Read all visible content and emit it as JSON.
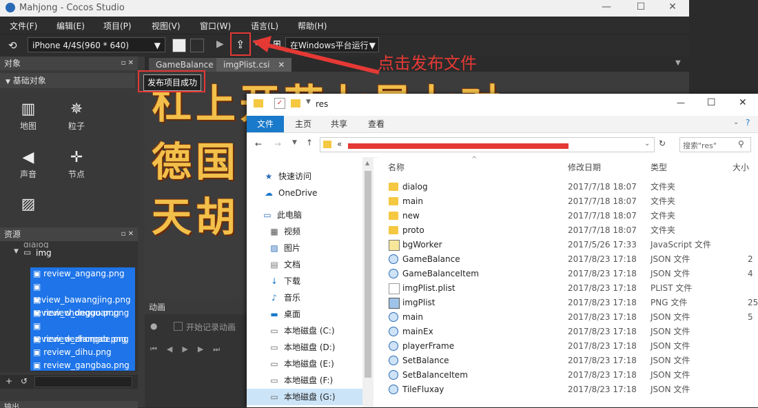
{
  "window": {
    "title": "Mahjong - Cocos Studio"
  },
  "menu": [
    "文件(F)",
    "编辑(E)",
    "项目(P)",
    "视图(V)",
    "窗口(W)",
    "语言(L)",
    "帮助(H)"
  ],
  "toolbar": {
    "device": "iPhone 4/4S(960 * 640)",
    "run_target": "在Windows平台运行"
  },
  "objects_panel": {
    "title": "对象",
    "section": "基础对象",
    "items": [
      {
        "label": "地图",
        "icon": "map-icon"
      },
      {
        "label": "粒子",
        "icon": "particle-icon"
      },
      {
        "label": "声音",
        "icon": "sound-icon"
      },
      {
        "label": "节点",
        "icon": "node-icon"
      },
      {
        "label": "",
        "icon": "image-icon"
      }
    ]
  },
  "resources_panel": {
    "title": "资源",
    "partial_item": "dialog",
    "folder": "img",
    "files": [
      "review_angang.png",
      "review_bawangjing.png",
      "review_chongguan.png",
      "review_deguo.png",
      "review_dezhongde.png",
      "review_dianpao.png",
      "review_dihu.png",
      "review_gangbao.png"
    ]
  },
  "tabs": [
    "GameBalance",
    "imgPlist.csi"
  ],
  "canvas": {
    "calligraphy": [
      "杠上开花七星七对",
      "德国",
      "天胡"
    ]
  },
  "success_message": "发布项目成功",
  "animation_panel": {
    "title": "动画",
    "record_label": "开始记录动画"
  },
  "output_panel": {
    "title": "输出"
  },
  "annotation": {
    "text": "点击发布文件",
    "color": "#e53935"
  },
  "explorer": {
    "title": "res",
    "ribbon_tabs": [
      "文件",
      "主页",
      "共享",
      "查看"
    ],
    "search_placeholder": "搜索\"res\"",
    "address_prefix": "«",
    "nav": [
      {
        "label": "快速访问",
        "icon": "star-icon"
      },
      {
        "label": "OneDrive",
        "icon": "cloud-icon"
      },
      {
        "label": "此电脑",
        "icon": "computer-icon"
      },
      {
        "label": "视频",
        "icon": "video-icon"
      },
      {
        "label": "图片",
        "icon": "picture-icon"
      },
      {
        "label": "文档",
        "icon": "document-icon"
      },
      {
        "label": "下载",
        "icon": "download-icon"
      },
      {
        "label": "音乐",
        "icon": "music-icon"
      },
      {
        "label": "桌面",
        "icon": "desktop-icon"
      },
      {
        "label": "本地磁盘 (C:)",
        "icon": "disk-icon"
      },
      {
        "label": "本地磁盘 (D:)",
        "icon": "disk-icon"
      },
      {
        "label": "本地磁盘 (E:)",
        "icon": "disk-icon"
      },
      {
        "label": "本地磁盘 (F:)",
        "icon": "disk-icon"
      },
      {
        "label": "本地磁盘 (G:)",
        "icon": "disk-icon"
      }
    ],
    "columns": {
      "name": "名称",
      "date": "修改日期",
      "type": "类型",
      "size": "大小"
    },
    "files": [
      {
        "name": "dialog",
        "date": "2017/7/18 18:07",
        "type": "文件夹",
        "size": "",
        "icon": "folder"
      },
      {
        "name": "main",
        "date": "2017/7/18 18:07",
        "type": "文件夹",
        "size": "",
        "icon": "folder"
      },
      {
        "name": "new",
        "date": "2017/7/18 18:07",
        "type": "文件夹",
        "size": "",
        "icon": "folder"
      },
      {
        "name": "proto",
        "date": "2017/7/18 18:07",
        "type": "文件夹",
        "size": "",
        "icon": "folder"
      },
      {
        "name": "bgWorker",
        "date": "2017/5/26 17:33",
        "type": "JavaScript 文件",
        "size": "",
        "icon": "js"
      },
      {
        "name": "GameBalance",
        "date": "2017/8/23 17:18",
        "type": "JSON 文件",
        "size": "2",
        "icon": "json"
      },
      {
        "name": "GameBalanceItem",
        "date": "2017/8/23 17:18",
        "type": "JSON 文件",
        "size": "4",
        "icon": "json"
      },
      {
        "name": "imgPlist.plist",
        "date": "2017/8/23 17:18",
        "type": "PLIST 文件",
        "size": "",
        "icon": "plist"
      },
      {
        "name": "imgPlist",
        "date": "2017/8/23 17:18",
        "type": "PNG 文件",
        "size": "25",
        "icon": "png"
      },
      {
        "name": "main",
        "date": "2017/8/23 17:18",
        "type": "JSON 文件",
        "size": "5",
        "icon": "json"
      },
      {
        "name": "mainEx",
        "date": "2017/8/23 17:18",
        "type": "JSON 文件",
        "size": "",
        "icon": "json"
      },
      {
        "name": "playerFrame",
        "date": "2017/8/23 17:18",
        "type": "JSON 文件",
        "size": "",
        "icon": "json"
      },
      {
        "name": "SetBalance",
        "date": "2017/8/23 17:18",
        "type": "JSON 文件",
        "size": "",
        "icon": "json"
      },
      {
        "name": "SetBalanceItem",
        "date": "2017/8/23 17:18",
        "type": "JSON 文件",
        "size": "",
        "icon": "json"
      },
      {
        "name": "TileFluxay",
        "date": "2017/8/23 17:18",
        "type": "JSON 文件",
        "size": "",
        "icon": "json"
      }
    ]
  }
}
